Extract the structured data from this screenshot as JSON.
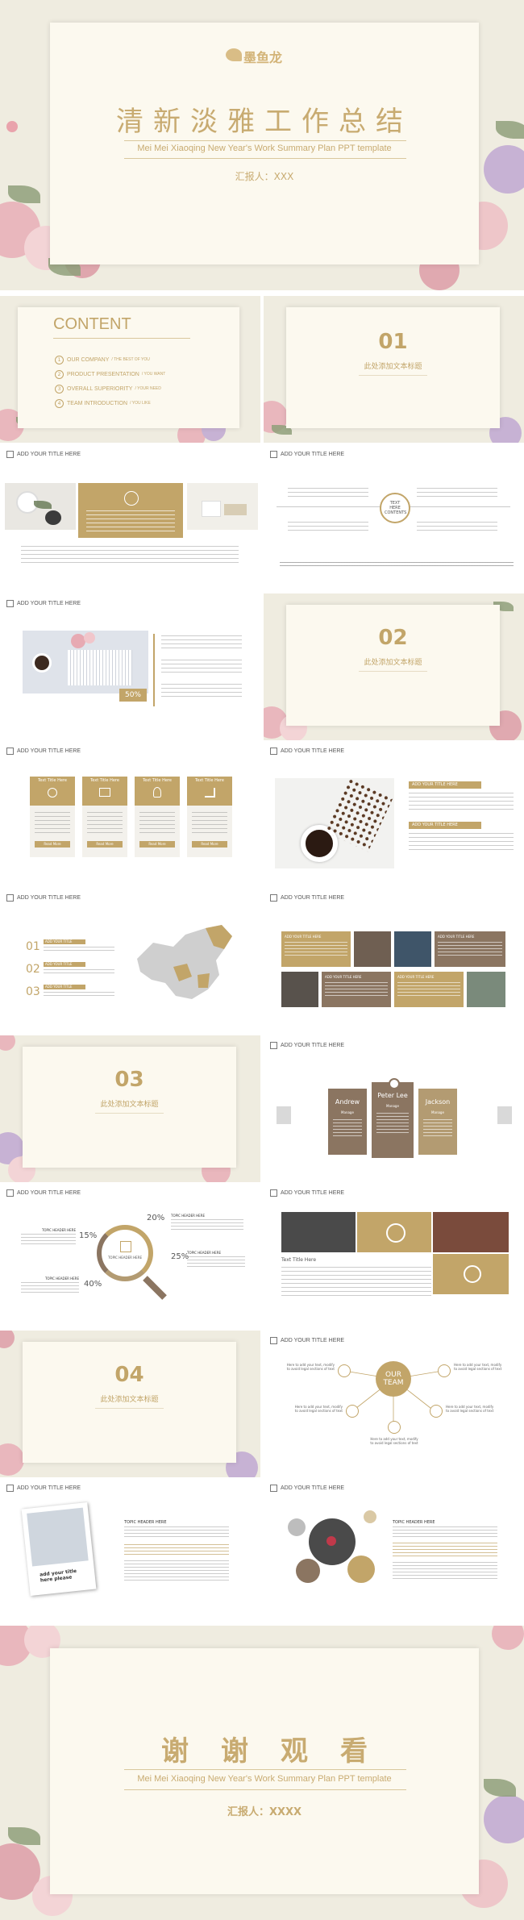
{
  "cover": {
    "logo_text": "墨鱼龙",
    "title": "清新淡雅工作总结",
    "subtitle": "Mei Mei Xiaoqing New Year's Work Summary Plan PPT template",
    "reporter": "汇报人：XXX"
  },
  "contents": {
    "heading": "CONTENT",
    "items": [
      {
        "num": "1",
        "label": "OUR COMPANY",
        "sub": "/ THE BEST OF YOU"
      },
      {
        "num": "2",
        "label": "PRODUCT PRESENTATION",
        "sub": "/ YOU WANT"
      },
      {
        "num": "3",
        "label": "OVERALL SUPERIORITY",
        "sub": "/ YOUR NEED"
      },
      {
        "num": "4",
        "label": "TEAM INTRODUCTION",
        "sub": "/ YOU LIKE"
      }
    ]
  },
  "sections": [
    {
      "num": "01",
      "title": "此处添加文本标题"
    },
    {
      "num": "02",
      "title": "此处添加文本标题"
    },
    {
      "num": "03",
      "title": "此处添加文本标题"
    },
    {
      "num": "04",
      "title": "此处添加文本标题"
    }
  ],
  "slide_tag": "ADD YOUR TITLE HERE",
  "slide4": {
    "center_label": "TEXT HERE CONTENTS"
  },
  "slide5": {
    "percent": "50%"
  },
  "slide7": {
    "box_title": "Text Title Here",
    "btn": "Read More"
  },
  "slide8": {
    "head1": "ADD YOUR TITLE HERE",
    "head2": "ADD YOUR TITLE HERE"
  },
  "slide9": {
    "nums": [
      "01",
      "02",
      "03"
    ],
    "label": "ADD YOUR TITLE"
  },
  "slide10": {
    "head": "ADD YOUR TITLE HERE"
  },
  "slide12": {
    "names": [
      "Andrew",
      "Peter Lee",
      "Jackson"
    ],
    "roles": [
      "Manage",
      "Manage",
      "Manage"
    ]
  },
  "slide13": {
    "percents": [
      "20%",
      "15%",
      "25%",
      "40%"
    ],
    "header": "TOPIC HEADER HERE",
    "center": "TOPIC HEADER HERE"
  },
  "slide14": {
    "title": "Text Title Here"
  },
  "slide16": {
    "center": "OUR TEAM",
    "note": "Here to add your text, modify to avoid legal sections of text"
  },
  "slide17": {
    "caption": "add your title here please",
    "header": "TOPIC HEADER HERE"
  },
  "slide18": {
    "header": "TOPIC HEADER HERE"
  },
  "end": {
    "title": "谢谢观看",
    "subtitle": "Mei Mei Xiaoqing New Year's Work Summary Plan PPT template",
    "reporter": "汇报人：XXXX"
  },
  "colors": {
    "gold": "#c2a569",
    "brown": "#8b7561",
    "tan": "#b39b72",
    "cream": "#fcf9ef"
  }
}
